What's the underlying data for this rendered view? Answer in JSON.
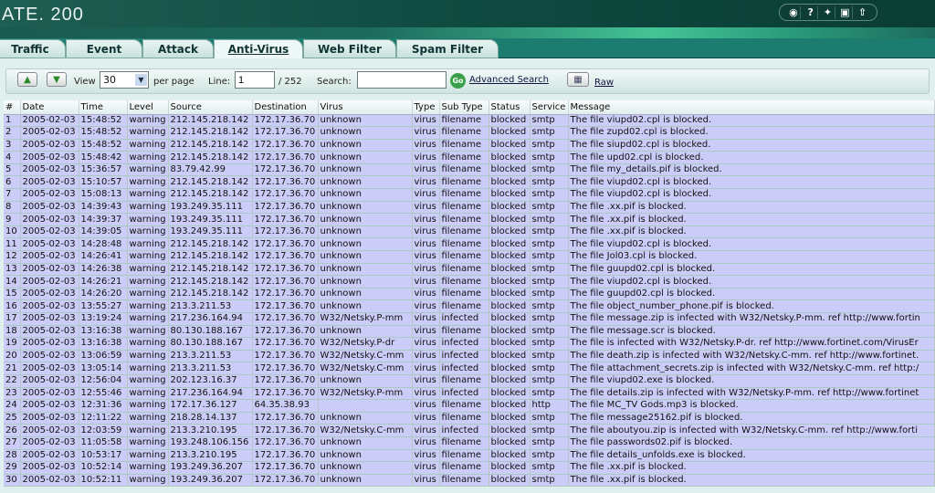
{
  "header": {
    "logo": "ATE. 200",
    "icons": [
      "chat-icon",
      "help-icon",
      "console-icon",
      "cli-icon",
      "logout-icon"
    ]
  },
  "tabs": [
    {
      "label": "Traffic"
    },
    {
      "label": "Event"
    },
    {
      "label": "Attack"
    },
    {
      "label": "Anti-Virus",
      "active": true
    },
    {
      "label": "Web Filter"
    },
    {
      "label": "Spam Filter"
    }
  ],
  "toolbar": {
    "view_label": "View",
    "per_page_value": "30",
    "per_page_label": "per page",
    "line_label": "Line:",
    "line_value": "1",
    "total": "/ 252",
    "search_label": "Search:",
    "search_value": "",
    "go_label": "Go",
    "advanced_search": "Advanced Search",
    "raw": "Raw"
  },
  "table": {
    "columns": [
      "#",
      "Date",
      "Time",
      "Level",
      "Source",
      "Destination",
      "Virus",
      "Type",
      "Sub Type",
      "Status",
      "Service",
      "Message"
    ],
    "rows": [
      [
        "1",
        "2005-02-03",
        "15:48:52",
        "warning",
        "212.145.218.142",
        "172.17.36.70",
        "unknown",
        "virus",
        "filename",
        "blocked",
        "smtp",
        "The file viupd02.cpl is blocked."
      ],
      [
        "2",
        "2005-02-03",
        "15:48:52",
        "warning",
        "212.145.218.142",
        "172.17.36.70",
        "unknown",
        "virus",
        "filename",
        "blocked",
        "smtp",
        "The file zupd02.cpl is blocked."
      ],
      [
        "3",
        "2005-02-03",
        "15:48:52",
        "warning",
        "212.145.218.142",
        "172.17.36.70",
        "unknown",
        "virus",
        "filename",
        "blocked",
        "smtp",
        "The file siupd02.cpl is blocked."
      ],
      [
        "4",
        "2005-02-03",
        "15:48:42",
        "warning",
        "212.145.218.142",
        "172.17.36.70",
        "unknown",
        "virus",
        "filename",
        "blocked",
        "smtp",
        "The file upd02.cpl is blocked."
      ],
      [
        "5",
        "2005-02-03",
        "15:36:57",
        "warning",
        "83.79.42.99",
        "172.17.36.70",
        "unknown",
        "virus",
        "filename",
        "blocked",
        "smtp",
        "The file my_details.pif is blocked."
      ],
      [
        "6",
        "2005-02-03",
        "15:10:57",
        "warning",
        "212.145.218.142",
        "172.17.36.70",
        "unknown",
        "virus",
        "filename",
        "blocked",
        "smtp",
        "The file viupd02.cpl is blocked."
      ],
      [
        "7",
        "2005-02-03",
        "15:08:13",
        "warning",
        "212.145.218.142",
        "172.17.36.70",
        "unknown",
        "virus",
        "filename",
        "blocked",
        "smtp",
        "The file viupd02.cpl is blocked."
      ],
      [
        "8",
        "2005-02-03",
        "14:39:43",
        "warning",
        "193.249.35.111",
        "172.17.36.70",
        "unknown",
        "virus",
        "filename",
        "blocked",
        "smtp",
        "The file .xx.pif is blocked."
      ],
      [
        "9",
        "2005-02-03",
        "14:39:37",
        "warning",
        "193.249.35.111",
        "172.17.36.70",
        "unknown",
        "virus",
        "filename",
        "blocked",
        "smtp",
        "The file .xx.pif is blocked."
      ],
      [
        "10",
        "2005-02-03",
        "14:39:05",
        "warning",
        "193.249.35.111",
        "172.17.36.70",
        "unknown",
        "virus",
        "filename",
        "blocked",
        "smtp",
        "The file .xx.pif is blocked."
      ],
      [
        "11",
        "2005-02-03",
        "14:28:48",
        "warning",
        "212.145.218.142",
        "172.17.36.70",
        "unknown",
        "virus",
        "filename",
        "blocked",
        "smtp",
        "The file viupd02.cpl is blocked."
      ],
      [
        "12",
        "2005-02-03",
        "14:26:41",
        "warning",
        "212.145.218.142",
        "172.17.36.70",
        "unknown",
        "virus",
        "filename",
        "blocked",
        "smtp",
        "The file Jol03.cpl is blocked."
      ],
      [
        "13",
        "2005-02-03",
        "14:26:38",
        "warning",
        "212.145.218.142",
        "172.17.36.70",
        "unknown",
        "virus",
        "filename",
        "blocked",
        "smtp",
        "The file guupd02.cpl is blocked."
      ],
      [
        "14",
        "2005-02-03",
        "14:26:21",
        "warning",
        "212.145.218.142",
        "172.17.36.70",
        "unknown",
        "virus",
        "filename",
        "blocked",
        "smtp",
        "The file viupd02.cpl is blocked."
      ],
      [
        "15",
        "2005-02-03",
        "14:26:20",
        "warning",
        "212.145.218.142",
        "172.17.36.70",
        "unknown",
        "virus",
        "filename",
        "blocked",
        "smtp",
        "The file guupd02.cpl is blocked."
      ],
      [
        "16",
        "2005-02-03",
        "13:55:27",
        "warning",
        "213.3.211.53",
        "172.17.36.70",
        "unknown",
        "virus",
        "filename",
        "blocked",
        "smtp",
        "The file object_number_phone.pif is blocked."
      ],
      [
        "17",
        "2005-02-03",
        "13:19:24",
        "warning",
        "217.236.164.94",
        "172.17.36.70",
        "W32/Netsky.P-mm",
        "virus",
        "infected",
        "blocked",
        "smtp",
        "The file message.zip is infected with W32/Netsky.P-mm. ref http://www.fortin"
      ],
      [
        "18",
        "2005-02-03",
        "13:16:38",
        "warning",
        "80.130.188.167",
        "172.17.36.70",
        "unknown",
        "virus",
        "filename",
        "blocked",
        "smtp",
        "The file message.scr is blocked."
      ],
      [
        "19",
        "2005-02-03",
        "13:16:38",
        "warning",
        "80.130.188.167",
        "172.17.36.70",
        "W32/Netsky.P-dr",
        "virus",
        "infected",
        "blocked",
        "smtp",
        "The file is infected with W32/Netsky.P-dr. ref http://www.fortinet.com/VirusEr"
      ],
      [
        "20",
        "2005-02-03",
        "13:06:59",
        "warning",
        "213.3.211.53",
        "172.17.36.70",
        "W32/Netsky.C-mm",
        "virus",
        "infected",
        "blocked",
        "smtp",
        "The file death.zip is infected with W32/Netsky.C-mm. ref http://www.fortinet."
      ],
      [
        "21",
        "2005-02-03",
        "13:05:14",
        "warning",
        "213.3.211.53",
        "172.17.36.70",
        "W32/Netsky.C-mm",
        "virus",
        "infected",
        "blocked",
        "smtp",
        "The file attachment_secrets.zip is infected with W32/Netsky.C-mm. ref http:/"
      ],
      [
        "22",
        "2005-02-03",
        "12:56:04",
        "warning",
        "202.123.16.37",
        "172.17.36.70",
        "unknown",
        "virus",
        "filename",
        "blocked",
        "smtp",
        "The file viupd02.exe is blocked."
      ],
      [
        "23",
        "2005-02-03",
        "12:55:46",
        "warning",
        "217.236.164.94",
        "172.17.36.70",
        "W32/Netsky.P-mm",
        "virus",
        "infected",
        "blocked",
        "smtp",
        "The file details.zip is infected with W32/Netsky.P-mm. ref http://www.fortinet"
      ],
      [
        "24",
        "2005-02-03",
        "12:31:36",
        "warning",
        "172.17.36.127",
        "64.35.38.93",
        "",
        "virus",
        "filename",
        "blocked",
        "http",
        "The file MC_TV Gods.mp3 is blocked."
      ],
      [
        "25",
        "2005-02-03",
        "12:11:22",
        "warning",
        "218.28.14.137",
        "172.17.36.70",
        "unknown",
        "virus",
        "filename",
        "blocked",
        "smtp",
        "The file message25162.pif is blocked."
      ],
      [
        "26",
        "2005-02-03",
        "12:03:59",
        "warning",
        "213.3.210.195",
        "172.17.36.70",
        "W32/Netsky.C-mm",
        "virus",
        "infected",
        "blocked",
        "smtp",
        "The file aboutyou.zip is infected with W32/Netsky.C-mm. ref http://www.forti"
      ],
      [
        "27",
        "2005-02-03",
        "11:05:58",
        "warning",
        "193.248.106.156",
        "172.17.36.70",
        "unknown",
        "virus",
        "filename",
        "blocked",
        "smtp",
        "The file passwords02.pif is blocked."
      ],
      [
        "28",
        "2005-02-03",
        "10:53:17",
        "warning",
        "213.3.210.195",
        "172.17.36.70",
        "unknown",
        "virus",
        "filename",
        "blocked",
        "smtp",
        "The file details_unfolds.exe is blocked."
      ],
      [
        "29",
        "2005-02-03",
        "10:52:14",
        "warning",
        "193.249.36.207",
        "172.17.36.70",
        "unknown",
        "virus",
        "filename",
        "blocked",
        "smtp",
        "The file .xx.pif is blocked."
      ],
      [
        "30",
        "2005-02-03",
        "10:52:11",
        "warning",
        "193.249.36.207",
        "172.17.36.70",
        "unknown",
        "virus",
        "filename",
        "blocked",
        "smtp",
        "The file .xx.pif is blocked."
      ]
    ]
  }
}
